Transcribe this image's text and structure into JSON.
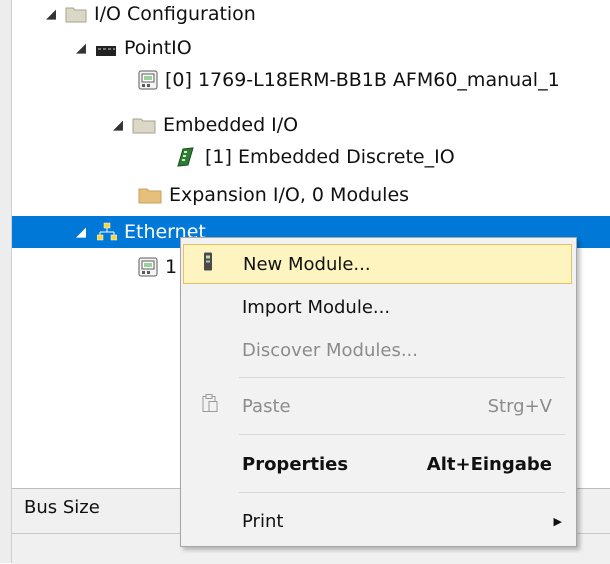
{
  "tree": {
    "items": [
      {
        "label": "I/O Configuration",
        "expander": "◢",
        "icon": "folder-icon"
      },
      {
        "label": "PointIO",
        "expander": "◢",
        "icon": "bus-icon"
      },
      {
        "label": "[0] 1769-L18ERM-BB1B AFM60_manual_1",
        "expander": "",
        "icon": "controller-module-icon"
      },
      {
        "label": "Embedded I/O",
        "expander": "◢",
        "icon": "folder-icon"
      },
      {
        "label": "[1] Embedded Discrete_IO",
        "expander": "",
        "icon": "discrete-io-module-icon"
      },
      {
        "label": "Expansion I/O, 0 Modules",
        "expander": "",
        "icon": "folder-icon"
      },
      {
        "label": "Ethernet",
        "expander": "◢",
        "icon": "network-icon",
        "selected": true
      },
      {
        "label": "1",
        "expander": "",
        "icon": "controller-module-icon"
      }
    ]
  },
  "bottom_panel": {
    "bus_size_label": "Bus Size"
  },
  "context_menu": {
    "items": [
      {
        "label": "New Module...",
        "accel": "",
        "icon": "new-module-icon",
        "highlighted": true
      },
      {
        "label": "Import Module...",
        "accel": ""
      },
      {
        "label": "Discover Modules...",
        "accel": "",
        "disabled": true
      },
      {
        "label": "Paste",
        "accel": "Strg+V",
        "icon": "paste-icon",
        "disabled": true
      },
      {
        "label": "Properties",
        "accel": "Alt+Eingabe",
        "bold": true
      },
      {
        "label": "Print",
        "accel": "",
        "submenu_arrow": "▶"
      }
    ]
  },
  "colors": {
    "selection": "#0078d7",
    "menu_highlight": "#fdf4bf",
    "menu_bg": "#f2f2f2"
  }
}
